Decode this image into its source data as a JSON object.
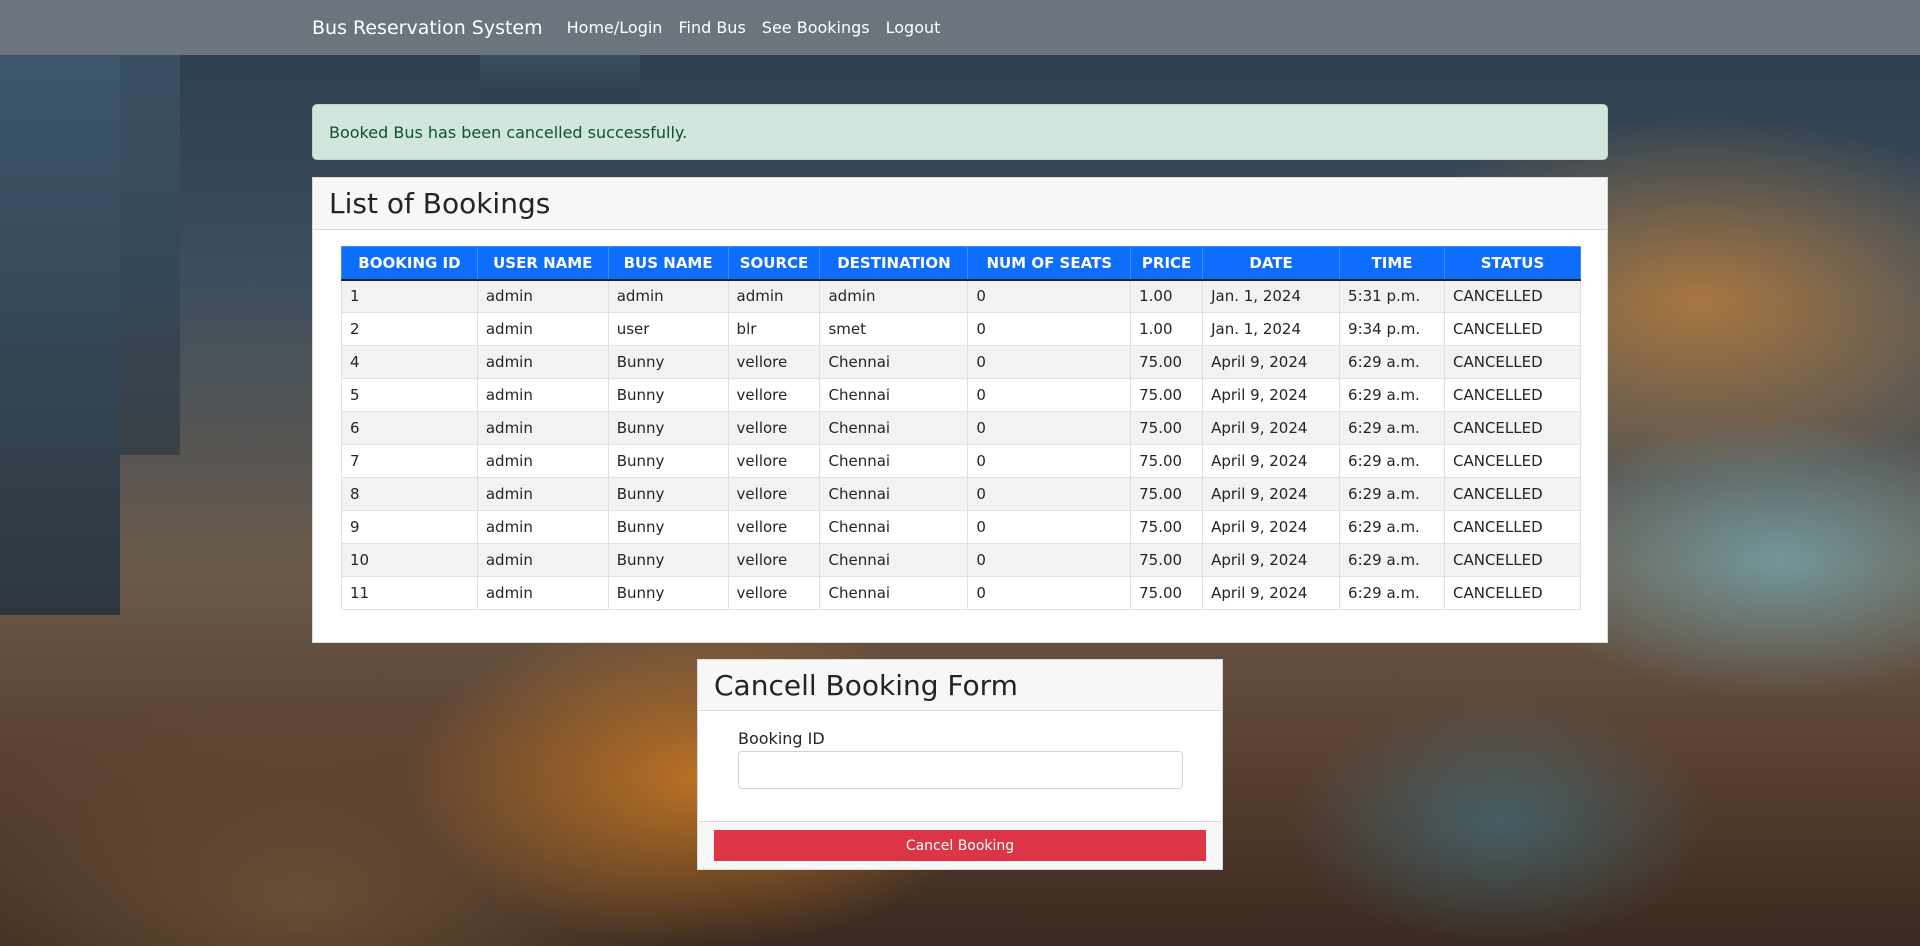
{
  "navbar": {
    "brand": "Bus Reservation System",
    "links": [
      "Home/Login",
      "Find Bus",
      "See Bookings",
      "Logout"
    ]
  },
  "alert": {
    "message": "Booked Bus has been cancelled successfully."
  },
  "bookings": {
    "title": "List of Bookings",
    "columns": [
      "BOOKING ID",
      "USER NAME",
      "BUS NAME",
      "SOURCE",
      "DESTINATION",
      "NUM OF SEATS",
      "PRICE",
      "DATE",
      "TIME",
      "STATUS"
    ],
    "rows": [
      [
        "1",
        "admin",
        "admin",
        "admin",
        "admin",
        "0",
        "1.00",
        "Jan. 1, 2024",
        "5:31 p.m.",
        "CANCELLED"
      ],
      [
        "2",
        "admin",
        "user",
        "blr",
        "smet",
        "0",
        "1.00",
        "Jan. 1, 2024",
        "9:34 p.m.",
        "CANCELLED"
      ],
      [
        "4",
        "admin",
        "Bunny",
        "vellore",
        "Chennai",
        "0",
        "75.00",
        "April 9, 2024",
        "6:29 a.m.",
        "CANCELLED"
      ],
      [
        "5",
        "admin",
        "Bunny",
        "vellore",
        "Chennai",
        "0",
        "75.00",
        "April 9, 2024",
        "6:29 a.m.",
        "CANCELLED"
      ],
      [
        "6",
        "admin",
        "Bunny",
        "vellore",
        "Chennai",
        "0",
        "75.00",
        "April 9, 2024",
        "6:29 a.m.",
        "CANCELLED"
      ],
      [
        "7",
        "admin",
        "Bunny",
        "vellore",
        "Chennai",
        "0",
        "75.00",
        "April 9, 2024",
        "6:29 a.m.",
        "CANCELLED"
      ],
      [
        "8",
        "admin",
        "Bunny",
        "vellore",
        "Chennai",
        "0",
        "75.00",
        "April 9, 2024",
        "6:29 a.m.",
        "CANCELLED"
      ],
      [
        "9",
        "admin",
        "Bunny",
        "vellore",
        "Chennai",
        "0",
        "75.00",
        "April 9, 2024",
        "6:29 a.m.",
        "CANCELLED"
      ],
      [
        "10",
        "admin",
        "Bunny",
        "vellore",
        "Chennai",
        "0",
        "75.00",
        "April 9, 2024",
        "6:29 a.m.",
        "CANCELLED"
      ],
      [
        "11",
        "admin",
        "Bunny",
        "vellore",
        "Chennai",
        "0",
        "75.00",
        "April 9, 2024",
        "6:29 a.m.",
        "CANCELLED"
      ]
    ]
  },
  "cancel_form": {
    "title": "Cancell Booking Form",
    "field_label": "Booking ID",
    "field_value": "",
    "button_label": "Cancel Booking"
  },
  "colors": {
    "navbar": "#6c757d",
    "table_header": "#0d6efd",
    "alert_bg": "#d1e7dd",
    "danger": "#dc3545"
  }
}
